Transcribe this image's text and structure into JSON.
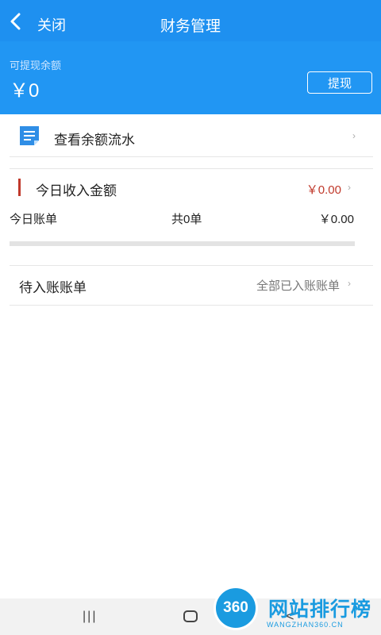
{
  "header": {
    "close_label": "关闭",
    "title": "财务管理",
    "balance_label": "可提现余额",
    "balance_value": "￥0",
    "withdraw_label": "提现"
  },
  "flow": {
    "label": "查看余额流水",
    "icon": "document-icon",
    "chevron": "›"
  },
  "income": {
    "label": "今日收入金额",
    "value": "￥0.00",
    "chevron": "›"
  },
  "bills": {
    "label": "今日账单",
    "count": "共0单",
    "amount": "￥0.00"
  },
  "pending": {
    "label": "待入账账单",
    "link": "全部已入账账单",
    "chevron": "›"
  },
  "navbar": {
    "recent": "|||",
    "back": "<"
  },
  "watermark": {
    "badge": "360",
    "text": "网站排行榜",
    "sub": "WANGZHAN360.CN"
  },
  "colors": {
    "primary": "#2196f3",
    "accent_red": "#c0392b",
    "watermark": "#1a9be0"
  }
}
